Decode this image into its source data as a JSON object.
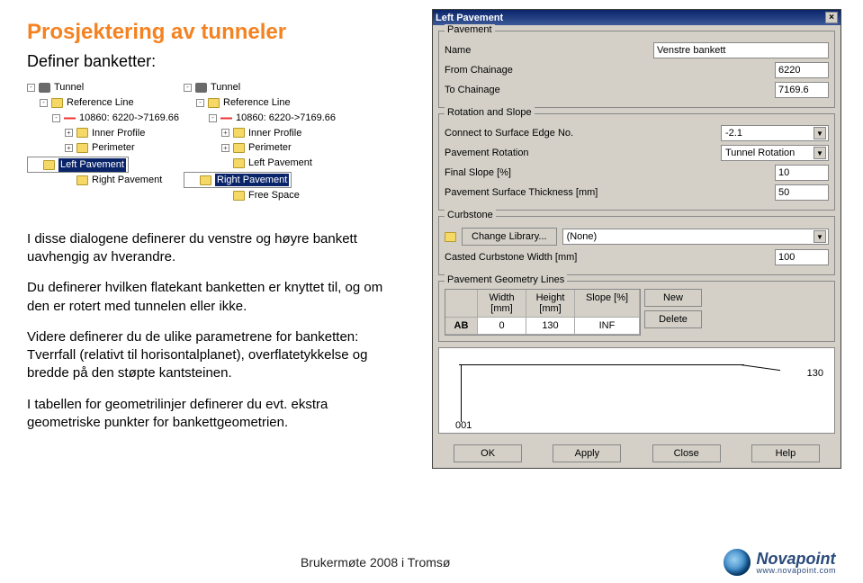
{
  "title": "Prosjektering av tunneler",
  "subtitle": "Definer banketter:",
  "trees": {
    "left": [
      {
        "depth": 0,
        "exp": "-",
        "icon": "road",
        "label": "Tunnel"
      },
      {
        "depth": 1,
        "exp": "-",
        "icon": "folder",
        "label": "Reference Line"
      },
      {
        "depth": 2,
        "exp": "-",
        "icon": "line",
        "label": "10860: 6220->7169.66"
      },
      {
        "depth": 3,
        "exp": "+",
        "icon": "folder",
        "label": "Inner Profile"
      },
      {
        "depth": 3,
        "exp": "+",
        "icon": "folder",
        "label": "Perimeter"
      },
      {
        "depth": 3,
        "exp": "",
        "icon": "folder",
        "label": "Left Pavement",
        "selected": true
      },
      {
        "depth": 3,
        "exp": "",
        "icon": "folder",
        "label": "Right Pavement"
      }
    ],
    "right": [
      {
        "depth": 0,
        "exp": "-",
        "icon": "road",
        "label": "Tunnel"
      },
      {
        "depth": 1,
        "exp": "-",
        "icon": "folder",
        "label": "Reference Line"
      },
      {
        "depth": 2,
        "exp": "-",
        "icon": "line",
        "label": "10860: 6220->7169.66"
      },
      {
        "depth": 3,
        "exp": "+",
        "icon": "folder",
        "label": "Inner Profile"
      },
      {
        "depth": 3,
        "exp": "+",
        "icon": "folder",
        "label": "Perimeter"
      },
      {
        "depth": 3,
        "exp": "",
        "icon": "folder",
        "label": "Left Pavement"
      },
      {
        "depth": 3,
        "exp": "",
        "icon": "folder",
        "label": "Right Pavement",
        "selected": true
      },
      {
        "depth": 3,
        "exp": "",
        "icon": "folder",
        "label": "Free Space"
      }
    ]
  },
  "body": {
    "p1": "I disse dialogene definerer du venstre og høyre bankett uavhengig av hverandre.",
    "p2": "Du definerer hvilken flatekant banketten er knyttet til, og om den er rotert med tunnelen eller ikke.",
    "p3": "Videre definerer du de ulike parametrene for banketten: Tverrfall (relativt til horisontalplanet), overflatetykkelse og bredde på den støpte kantsteinen.",
    "p4": "I tabellen for geometrilinjer definerer du evt. ekstra geometriske punkter for bankettgeometrien."
  },
  "dialog": {
    "title": "Left Pavement",
    "groups": {
      "pavement": {
        "title": "Pavement",
        "name_label": "Name",
        "name_value": "Venstre bankett",
        "from_label": "From Chainage",
        "from_value": "6220",
        "to_label": "To Chainage",
        "to_value": "7169.6"
      },
      "rotation": {
        "title": "Rotation and Slope",
        "connect_label": "Connect to Surface Edge No.",
        "connect_value": "-2.1",
        "rot_label": "Pavement Rotation",
        "rot_value": "Tunnel Rotation",
        "slope_label": "Final Slope  [%]",
        "slope_value": "10",
        "thick_label": "Pavement Surface Thickness [mm]",
        "thick_value": "50"
      },
      "curbstone": {
        "title": "Curbstone",
        "change_btn": "Change Library...",
        "change_value": "(None)",
        "width_label": "Casted Curbstone Width [mm]",
        "width_value": "100"
      },
      "geom": {
        "title": "Pavement Geometry Lines",
        "h_lab": "",
        "h1": "Width [mm]",
        "h2": "Height [mm]",
        "h3": "Slope [%]",
        "row_lab": "AB",
        "r1": "0",
        "r2": "130",
        "r3": "INF",
        "new_btn": "New",
        "del_btn": "Delete"
      }
    },
    "diagram": {
      "l1": "130",
      "l2": "001"
    },
    "buttons": {
      "ok": "OK",
      "apply": "Apply",
      "close": "Close",
      "help": "Help"
    }
  },
  "footer": {
    "center": "Brukermøte 2008 i Tromsø",
    "logo_text": "Novapoint",
    "logo_sub": "www.novapoint.com"
  }
}
